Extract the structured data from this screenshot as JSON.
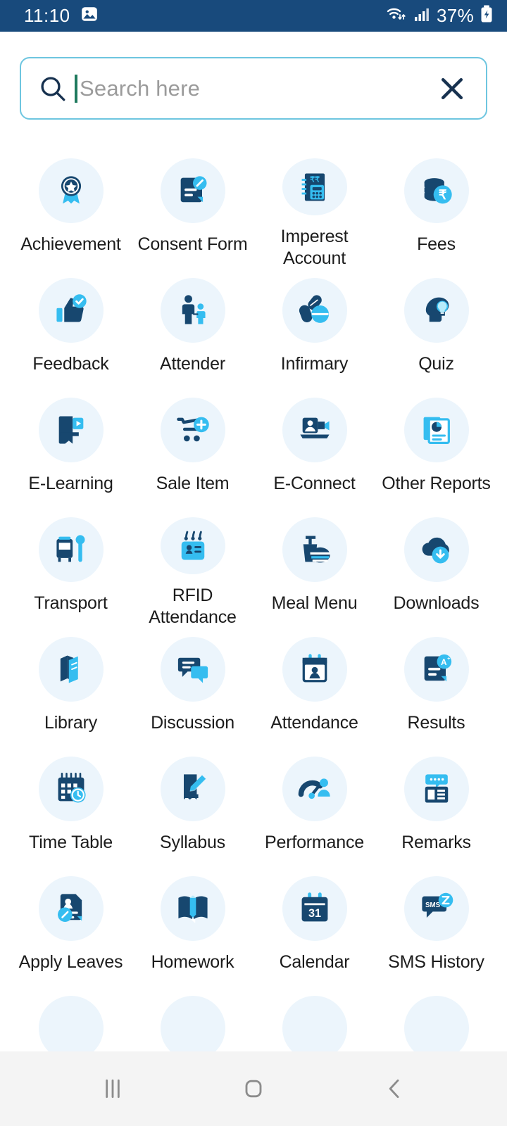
{
  "statusbar": {
    "time": "11:10",
    "battery_text": "37%",
    "icons": {
      "screenshot": "image-icon",
      "wifi": "wifi-icon",
      "signal": "cellular-signal-icon",
      "battery": "battery-charging-icon"
    },
    "background": "#184a7c"
  },
  "search": {
    "placeholder": "Search here",
    "value": "",
    "icon": "search-icon",
    "clear_icon": "close-icon",
    "border_color": "#6ec6e0",
    "caret_color": "#1f7a5e"
  },
  "grid": {
    "columns": 4,
    "circle_color": "#ecf5fc",
    "accent_dark": "#17476f",
    "accent_light": "#35bdf0",
    "items": [
      {
        "label": "Achievement",
        "icon": "award-medal-icon"
      },
      {
        "label": "Consent Form",
        "icon": "document-edit-icon"
      },
      {
        "label": "Imperest Account",
        "icon": "rupee-calculator-icon"
      },
      {
        "label": "Fees",
        "icon": "rupee-coins-icon"
      },
      {
        "label": "Feedback",
        "icon": "thumbs-up-check-icon"
      },
      {
        "label": "Attender",
        "icon": "adult-child-icon"
      },
      {
        "label": "Infirmary",
        "icon": "pills-icon"
      },
      {
        "label": "Quiz",
        "icon": "head-lightbulb-icon"
      },
      {
        "label": "E-Learning",
        "icon": "book-play-icon"
      },
      {
        "label": "Sale Item",
        "icon": "cart-plus-icon"
      },
      {
        "label": "E-Connect",
        "icon": "laptop-video-icon"
      },
      {
        "label": "Other Reports",
        "icon": "report-chart-icon"
      },
      {
        "label": "Transport",
        "icon": "bus-stop-icon"
      },
      {
        "label": "RFID Attendance",
        "icon": "rfid-card-icon"
      },
      {
        "label": "Meal Menu",
        "icon": "meal-drink-icon"
      },
      {
        "label": "Downloads",
        "icon": "cloud-download-icon"
      },
      {
        "label": "Library",
        "icon": "books-icon"
      },
      {
        "label": "Discussion",
        "icon": "chat-bubbles-icon"
      },
      {
        "label": "Attendance",
        "icon": "calendar-person-icon"
      },
      {
        "label": "Results",
        "icon": "grade-a-document-icon"
      },
      {
        "label": "Time Table",
        "icon": "calendar-clock-icon"
      },
      {
        "label": "Syllabus",
        "icon": "book-pencil-icon"
      },
      {
        "label": "Performance",
        "icon": "gauge-person-icon"
      },
      {
        "label": "Remarks",
        "icon": "note-comment-icon"
      },
      {
        "label": "Apply Leaves",
        "icon": "profile-edit-icon"
      },
      {
        "label": "Homework",
        "icon": "open-book-pencil-icon"
      },
      {
        "label": "Calendar",
        "icon": "calendar-31-icon",
        "badge": "31"
      },
      {
        "label": "SMS History",
        "icon": "sms-clock-icon",
        "badge": "SMS"
      },
      {
        "label": "",
        "icon": "partial-tile-icon"
      },
      {
        "label": "",
        "icon": "partial-tile-icon"
      },
      {
        "label": "",
        "icon": "partial-tile-icon"
      },
      {
        "label": "",
        "icon": "partial-tile-icon"
      }
    ]
  },
  "navbar": {
    "recents_label": "recent-apps",
    "home_label": "home",
    "back_label": "back",
    "background": "#f4f4f4"
  }
}
